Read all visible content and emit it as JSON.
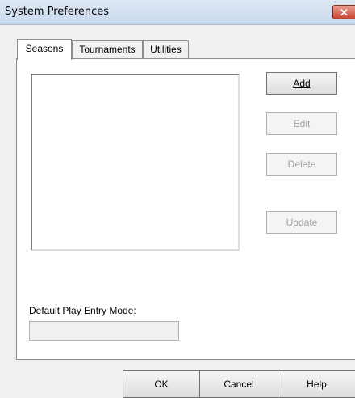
{
  "window": {
    "title": "System Preferences",
    "close_label": "✕"
  },
  "tabs": [
    {
      "label": "Seasons",
      "selected": true
    },
    {
      "label": "Tournaments",
      "selected": false
    },
    {
      "label": "Utilities",
      "selected": false
    }
  ],
  "seasons": {
    "list_items": [],
    "buttons": {
      "add": {
        "label": "Add",
        "enabled": true
      },
      "edit": {
        "label": "Edit",
        "enabled": false
      },
      "delete": {
        "label": "Delete",
        "enabled": false
      },
      "update": {
        "label": "Update",
        "enabled": false
      }
    }
  },
  "default_play": {
    "label": "Default Play Entry Mode:",
    "value": ""
  },
  "footer": {
    "ok": "OK",
    "cancel": "Cancel",
    "help": "Help"
  }
}
